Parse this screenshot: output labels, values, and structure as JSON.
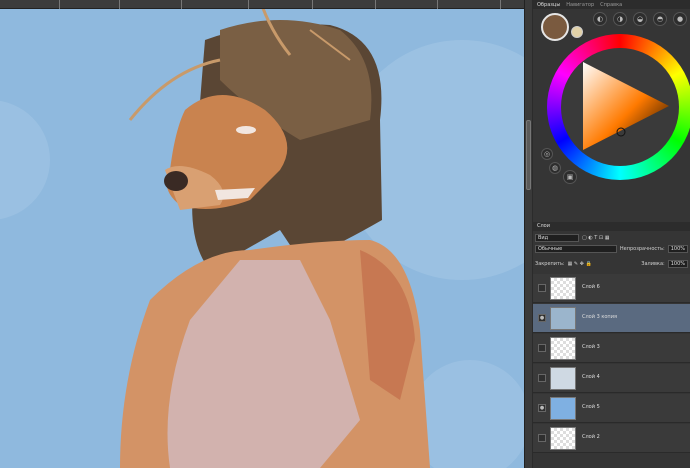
{
  "panel": {
    "tabs": [
      "Образцы",
      "Навигатор",
      "Справка"
    ],
    "layers_tab": "Слои",
    "filter_placeholder": "Вид",
    "blend_mode": "Обычные",
    "opacity_label": "Непрозрачность:",
    "opacity_value": "100%",
    "lock_label": "Закрепить:",
    "fill_label": "Заливка:",
    "fill_value": "100%",
    "layers": [
      {
        "name": "Слой 6",
        "visible": false,
        "selected": false
      },
      {
        "name": "Слой 3 копия",
        "visible": true,
        "selected": true
      },
      {
        "name": "Слой 3",
        "visible": false,
        "selected": false
      },
      {
        "name": "Слой 4",
        "visible": false,
        "selected": false
      },
      {
        "name": "Слой 5",
        "visible": true,
        "selected": false
      },
      {
        "name": "Слой 2",
        "visible": false,
        "selected": false
      }
    ]
  },
  "colors": {
    "foreground": "#7a5a3f",
    "background": "#e2d2a8",
    "canvas_bg": "#8fb9de"
  },
  "icons": [
    "eye-icon",
    "lock-icon",
    "brush-icon",
    "move-icon",
    "filter-icon"
  ]
}
